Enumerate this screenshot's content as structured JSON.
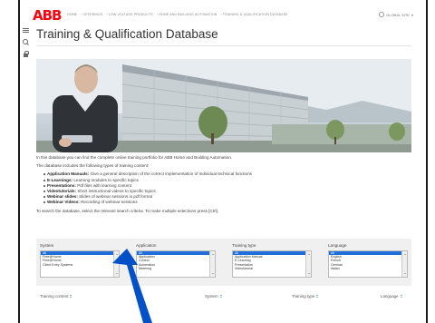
{
  "brand": {
    "logo": "ABB",
    "color": "#ff000f"
  },
  "breadcrumb": [
    "HOME",
    "OFFERINGS",
    "LOW VOLTAGE PRODUCTS",
    "HOME AND BUILDING AUTOMATION",
    "TRAINING & QUALIFICATION DATABASE"
  ],
  "header": {
    "language": "GLOBAL SITE"
  },
  "page": {
    "title": "Training & Qualification Database"
  },
  "content": {
    "intro": "In this database you can find the complete online training portfolio for ABB Home and Building Automation.",
    "types_intro": "The database includes the following types of training content:",
    "types": [
      {
        "name": "Application Manuals:",
        "desc": " Give a general description of the correct implementation of individual technical functions"
      },
      {
        "name": "E-Learnings:",
        "desc": " Learning modules to specific topics"
      },
      {
        "name": "Presentations:",
        "desc": " Pdf files with learning content"
      },
      {
        "name": "Videotutorials:",
        "desc": " Short instructional videos to specific topics"
      },
      {
        "name": "Webinar slides:",
        "desc": " Slides of webinar sessions in pdf format"
      },
      {
        "name": "Webinar Videos:",
        "desc": " Recording of webinar sessions"
      }
    ],
    "search_hint": "To search the database, select the relevant search criteria. To make multiple selections press [Ctrl]."
  },
  "filters": {
    "system": {
      "label": "System",
      "options": [
        "All",
        "Free@Home",
        "Free@Home",
        "Client Entry Systems"
      ]
    },
    "application": {
      "label": "Application",
      "options": [
        "All",
        "Application",
        "Control",
        "Automation",
        "Metering"
      ]
    },
    "training_type": {
      "label": "Training type",
      "options": [
        "All",
        "Application Manual",
        "E-Learning",
        "Presentation",
        "Videotutorial"
      ]
    },
    "language": {
      "label": "Language",
      "options": [
        "All",
        "English",
        "French",
        "German",
        "Italian"
      ]
    }
  },
  "results": {
    "columns": [
      "Training content",
      "System",
      "Training type",
      "Language"
    ]
  },
  "colors": {
    "accent": "#1e6fd9",
    "annotation": "#0050c8"
  }
}
